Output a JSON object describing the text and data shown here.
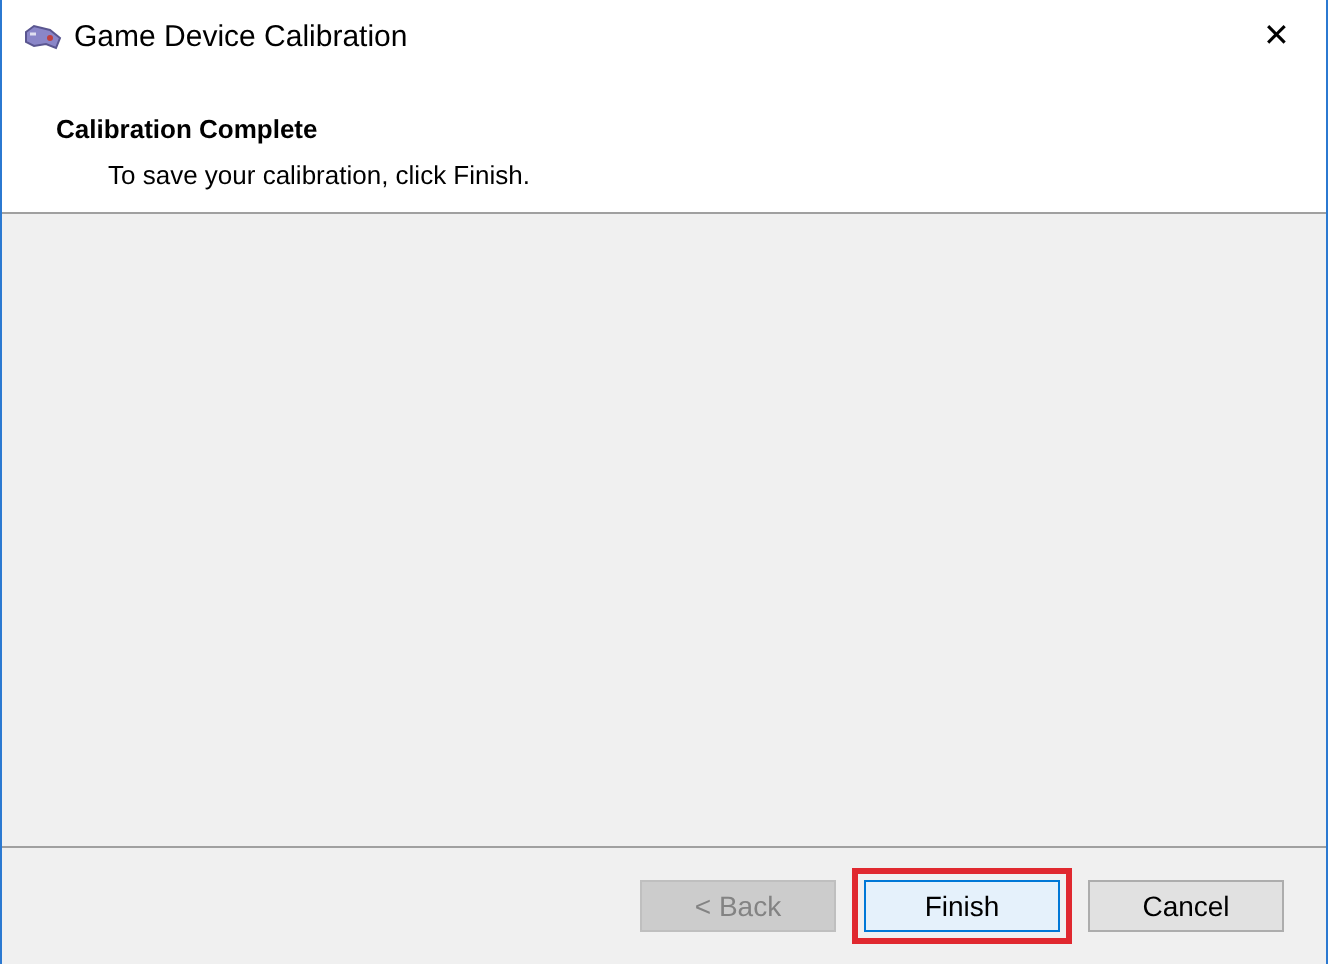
{
  "window": {
    "title": "Game Device Calibration",
    "close": "✕"
  },
  "header": {
    "title": "Calibration Complete",
    "subtitle": "To save your calibration, click Finish."
  },
  "buttons": [
    {
      "label": "< Back",
      "disabled": true,
      "default": false,
      "highlighted": false
    },
    {
      "label": "Finish",
      "disabled": false,
      "default": true,
      "highlighted": true
    },
    {
      "label": "Cancel",
      "disabled": false,
      "default": false,
      "highlighted": false
    }
  ]
}
